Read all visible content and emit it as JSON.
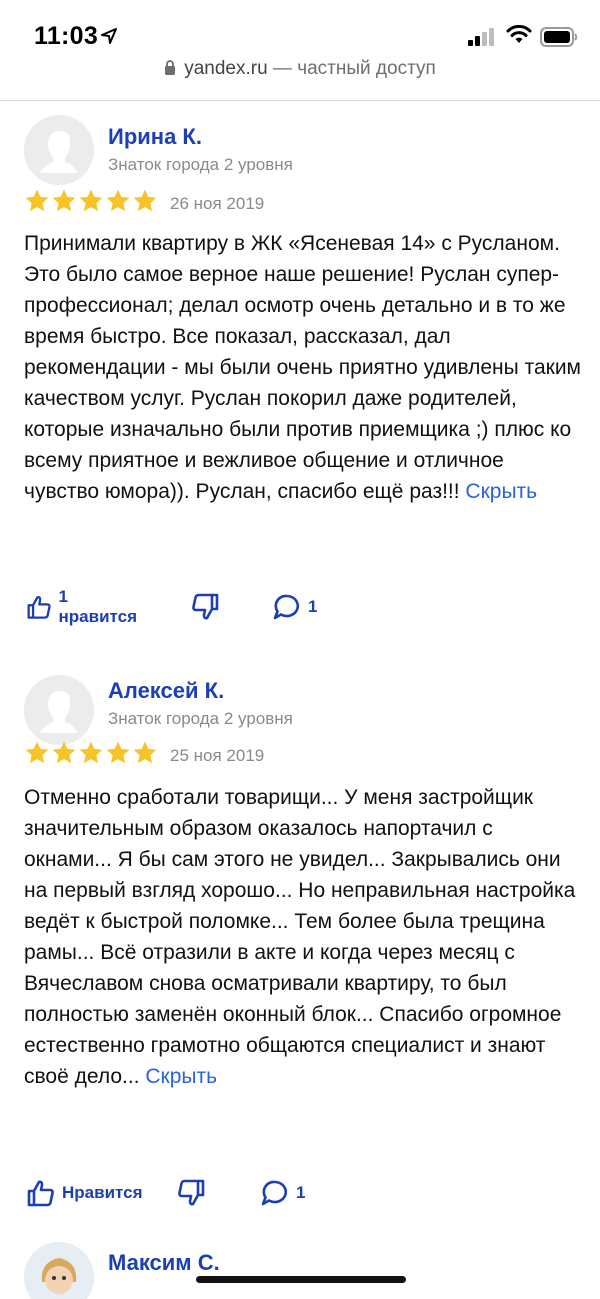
{
  "status_bar": {
    "time": "11:03"
  },
  "browser": {
    "host": "yandex.ru",
    "suffix": " — частный доступ"
  },
  "reviews": [
    {
      "author": "Ирина К.",
      "rank": "Знаток города 2 уровня",
      "rating": 5,
      "date": "26 ноя 2019",
      "text": "Принимали квартиру в ЖК «Ясеневая 14» с Русланом. Это было самое верное наше решение! Руслан супер-профессионал; делал осмотр очень детально и в то же время быстро. Все показал, рассказал, дал рекомендации - мы были очень приятно удивлены таким качеством услуг. Руслан покорил даже родителей, которые изначально были против приемщика ;) плюс ко всему приятное и вежливое общение и отличное чувство юмора)). Руслан, спасибо ещё раз!!! ",
      "hide_label": "Скрыть",
      "like_label": "1 нравится",
      "comments": "1"
    },
    {
      "author": "Алексей К.",
      "rank": "Знаток города 2 уровня",
      "rating": 5,
      "date": "25 ноя 2019",
      "text": "Отменно сработали товарищи... У меня застройщик значительным образом оказалось напортачил с окнами... Я бы сам этого не увидел... Закрывались они на первый взгляд хорошо... Но неправильная настройка ведёт к быстрой поломке... Тем более была трещина рамы... Всё отразили в акте и когда через месяц с Вячеславом снова осматривали квартиру, то был полностью заменён оконный блок... Спасибо огромное естественно грамотно общаются специалист и знают своё дело... ",
      "hide_label": "Скрыть",
      "like_label": "Нравится",
      "comments": "1"
    },
    {
      "author": "Максим С."
    }
  ],
  "colors": {
    "accent": "#1d3eb5",
    "link": "#2864d8",
    "star": "#f6c427",
    "meta": "#8a8a8a"
  }
}
